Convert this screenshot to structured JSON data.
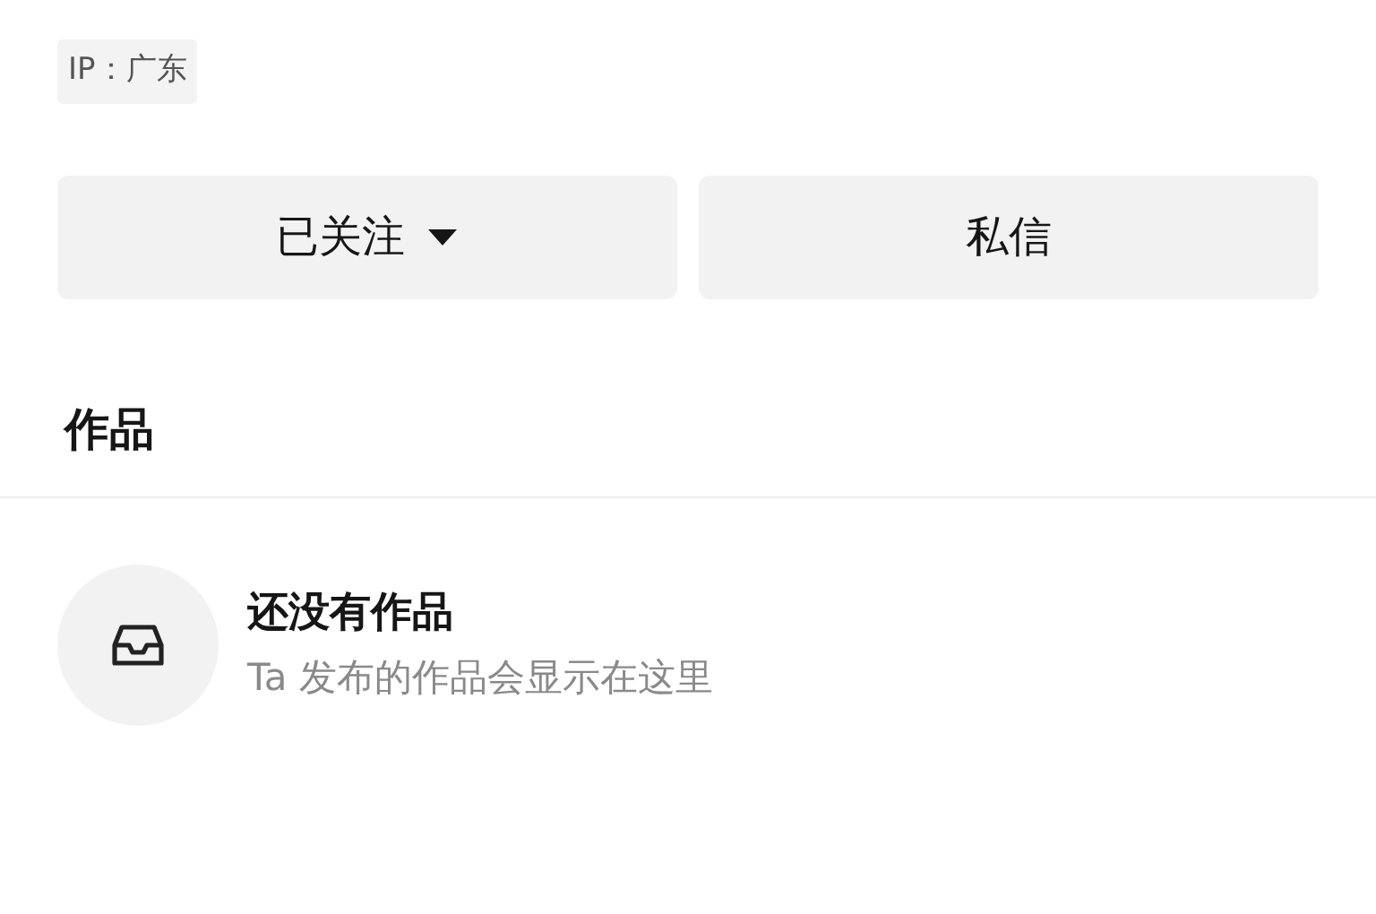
{
  "ip_badge": "IP：广东",
  "actions": [
    {
      "label": "已关注",
      "kind": "dropdown"
    },
    {
      "label": "私信",
      "kind": "plain"
    }
  ],
  "section_title": "作品",
  "empty_state": {
    "title": "还没有作品",
    "subtitle": "Ta 发布的作品会显示在这里"
  }
}
